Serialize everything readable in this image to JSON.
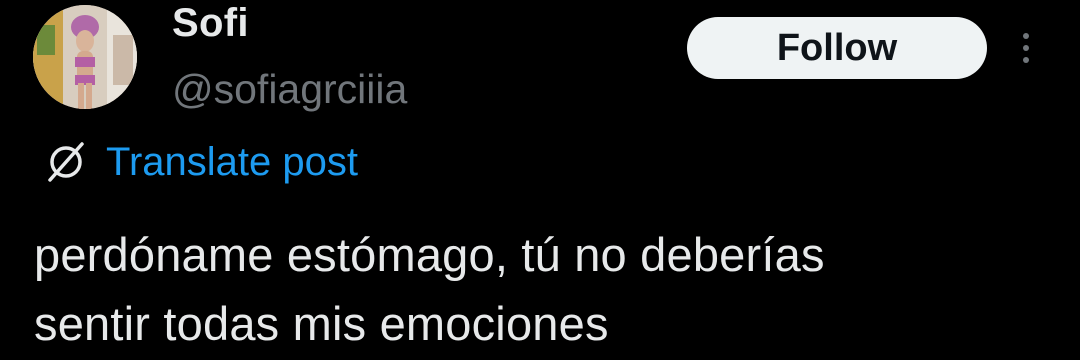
{
  "author": {
    "display_name": "Sofi",
    "handle": "@sofiagrciiia",
    "avatar_icon": "profile-photo"
  },
  "actions": {
    "follow_label": "Follow",
    "more_icon": "vertical-ellipsis-icon"
  },
  "translate": {
    "icon": "globe-slash-icon",
    "label": "Translate post"
  },
  "post": {
    "text_line_1": "perdóname estómago, tú no deberías",
    "text_line_2": "sentir todas mis emociones"
  },
  "colors": {
    "background": "#000000",
    "primary_text": "#e7e9ea",
    "secondary_text": "#71767b",
    "link": "#1d9bf0",
    "follow_bg": "#eff3f4",
    "follow_text": "#0f1419"
  }
}
